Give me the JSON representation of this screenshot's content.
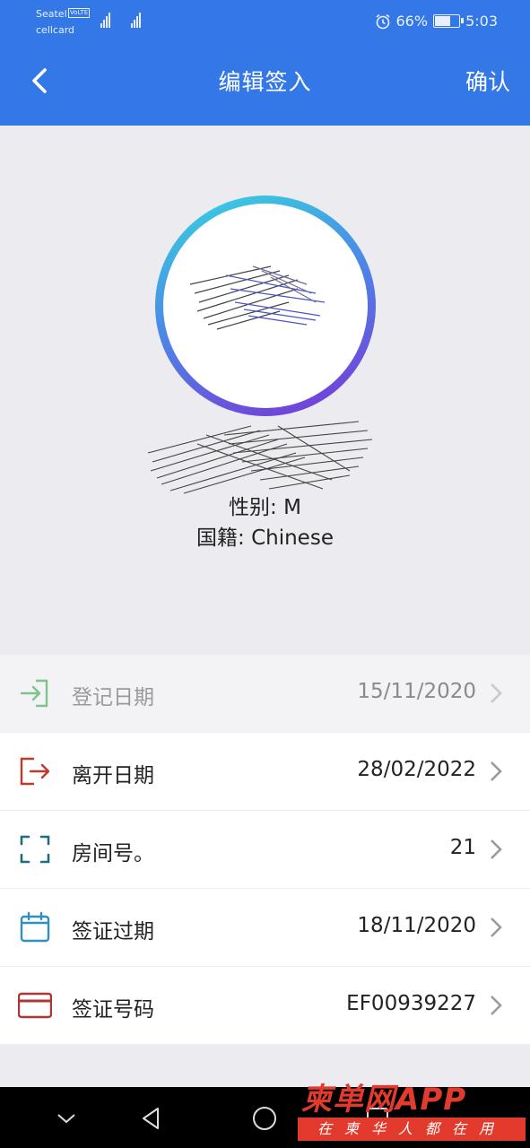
{
  "status_bar": {
    "carrier_1": "Seatel",
    "volte": "VoLTE",
    "carrier_2": "cellcard",
    "battery": "66%",
    "time": "5:03"
  },
  "header": {
    "title": "编辑签入",
    "confirm_label": "确认"
  },
  "profile": {
    "gender": "性别: M",
    "nationality": "国籍: Chinese"
  },
  "rows": [
    {
      "label": "登记日期",
      "value": "15/11/2020",
      "icon": "checkin-arrow-icon",
      "color": "#7cc48a",
      "disabled": true
    },
    {
      "label": "离开日期",
      "value": "28/02/2022",
      "icon": "checkout-arrow-icon",
      "color": "#c0392b"
    },
    {
      "label": "房间号。",
      "value": "21",
      "icon": "scan-frame-icon",
      "color": "#1f6f7a"
    },
    {
      "label": "签证过期",
      "value": "18/11/2020",
      "icon": "calendar-icon",
      "color": "#2f8fc2"
    },
    {
      "label": "签证号码",
      "value": "EF00939227",
      "icon": "card-icon",
      "color": "#b03535"
    }
  ],
  "watermark": {
    "brand": "柬单网APP",
    "slogan": "在柬华人都在用"
  },
  "colors": {
    "header_blue": "#3478e8",
    "accent_red": "#e23b2e"
  }
}
